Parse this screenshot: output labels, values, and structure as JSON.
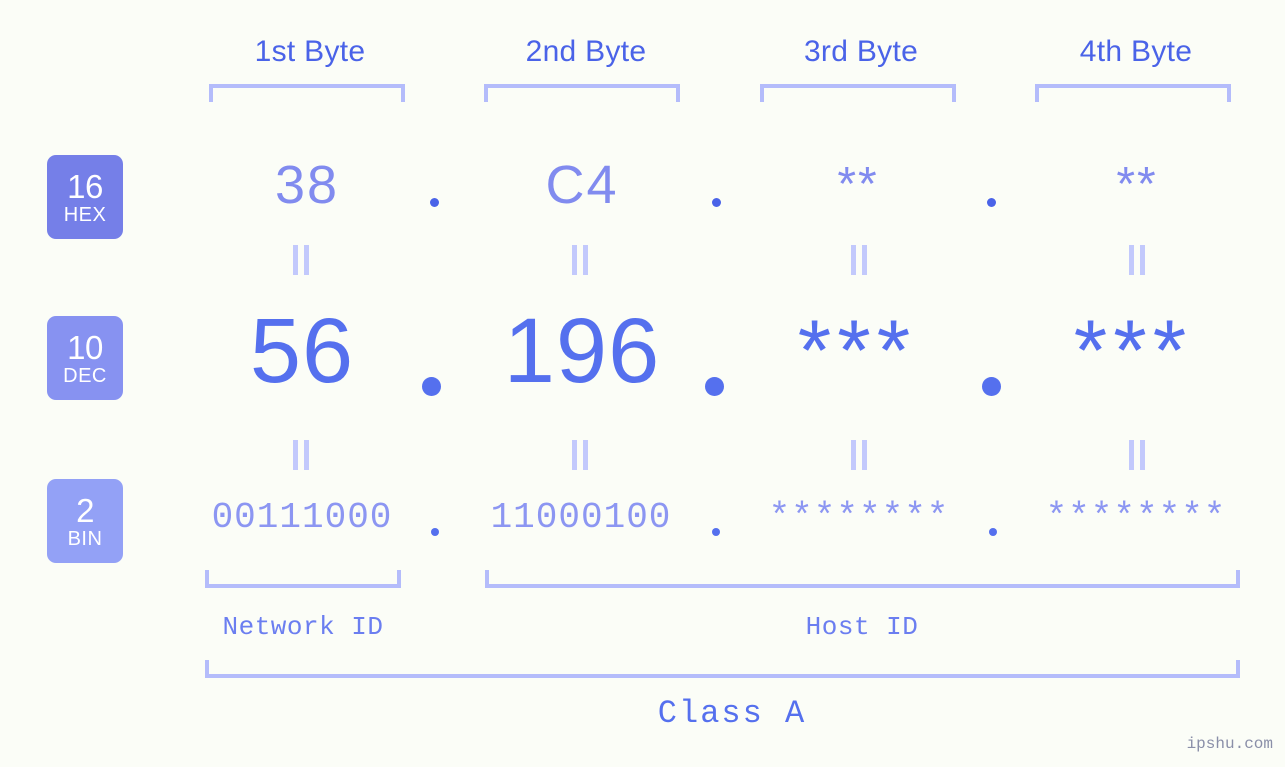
{
  "colors": {
    "background": "#fbfdf7",
    "accent_strong": "#4a63e8",
    "accent_mid": "#5570ee",
    "accent_light": "#818bef",
    "bracket": "#b4bcfb",
    "badge_hex": "#757fe8",
    "badge_dec": "#8792f1",
    "badge_bin": "#93a1f6",
    "watermark": "#8a8fa8"
  },
  "byte_headers": [
    {
      "label": "1st Byte"
    },
    {
      "label": "2nd Byte"
    },
    {
      "label": "3rd Byte"
    },
    {
      "label": "4th Byte"
    }
  ],
  "radix_rows": [
    {
      "number": "16",
      "name": "HEX",
      "values": [
        "38",
        "C4",
        "**",
        "**"
      ],
      "separator": "."
    },
    {
      "number": "10",
      "name": "DEC",
      "values": [
        "56",
        "196",
        "***",
        "***"
      ],
      "separator": "."
    },
    {
      "number": "2",
      "name": "BIN",
      "values": [
        "00111000",
        "11000100",
        "********",
        "********"
      ],
      "separator": "."
    }
  ],
  "equivalence_symbol": "=",
  "sections": [
    {
      "label": "Network ID"
    },
    {
      "label": "Host ID"
    }
  ],
  "class": {
    "label": "Class A"
  },
  "watermark": {
    "text": "ipshu.com"
  }
}
